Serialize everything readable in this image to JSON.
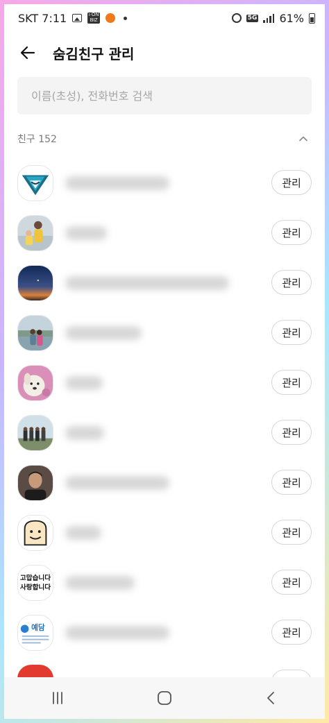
{
  "status_bar": {
    "carrier_time": "SKT 7:11",
    "battery_percent": "61%",
    "network_badge": "5G",
    "news_icon_label": "i-ON\nBIZ",
    "icons": [
      "image-icon",
      "news-icon",
      "orange-app-icon",
      "notification-dot-icon",
      "alarm-icon",
      "signal-icon",
      "battery-icon"
    ]
  },
  "header": {
    "title": "숨김친구 관리",
    "back_icon": "back-arrow-icon"
  },
  "search": {
    "value": "",
    "placeholder": "이름(초성), 전화번호 검색"
  },
  "section": {
    "label": "친구 152",
    "toggle_icon": "chevron-up-icon"
  },
  "friends": [
    {
      "avatar": "triangle-logo",
      "action": "관리"
    },
    {
      "avatar": "family-photo",
      "action": "관리"
    },
    {
      "avatar": "sunset-sky",
      "action": "관리"
    },
    {
      "avatar": "couple-by-lake",
      "action": "관리"
    },
    {
      "avatar": "dog-photo",
      "action": "관리"
    },
    {
      "avatar": "group-outdoors",
      "action": "관리"
    },
    {
      "avatar": "man-portrait",
      "action": "관리"
    },
    {
      "avatar": "bread-face-emoji",
      "action": "관리"
    },
    {
      "avatar": "calligraphy-text",
      "action": "관리"
    },
    {
      "avatar": "store-logo",
      "action": "관리"
    }
  ],
  "avatar_texts": {
    "calligraphy_line1": "고맙습니다",
    "calligraphy_line2": "사랑합니다",
    "store_logo": "예담"
  },
  "nav": {
    "recents_icon": "recents-icon",
    "home_icon": "home-icon",
    "back_icon": "nav-back-icon"
  },
  "colors": {
    "accent_text": "#111111",
    "search_bg": "#f4f4f4",
    "button_border": "#d6d6d6"
  }
}
